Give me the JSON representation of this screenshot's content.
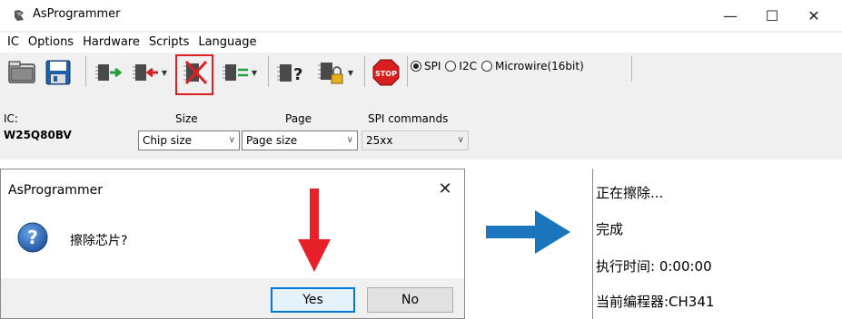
{
  "window": {
    "title": "AsProgrammer",
    "controls": {
      "minimize": "—",
      "maximize": "☐",
      "close": "✕"
    }
  },
  "menu": [
    "IC",
    "Options",
    "Hardware",
    "Scripts",
    "Language"
  ],
  "toolbar": {
    "icons": [
      "open-file-icon",
      "save-file-icon",
      "read-chip-icon",
      "write-chip-icon",
      "erase-chip-icon",
      "verify-chip-icon",
      "chip-id-icon",
      "lock-chip-icon",
      "stop-icon"
    ],
    "stop_label": "STOP",
    "highlighted_tool": "erase-chip-icon",
    "protocols": {
      "selected": "SPI",
      "spi": "SPI",
      "i2c": "I2C",
      "microwire": "Microwire(16bit)"
    }
  },
  "settings": {
    "ic_label": "IC:",
    "ic_value": "W25Q80BV",
    "size_label": "Size",
    "size_value": "Chip size",
    "page_label": "Page",
    "page_value": "Page size",
    "spi_label": "SPI commands",
    "spi_value": "25xx"
  },
  "dialog": {
    "title": "AsProgrammer",
    "close": "✕",
    "message": "擦除芯片?",
    "yes": "Yes",
    "no": "No"
  },
  "log": {
    "lines": [
      "正在擦除...",
      "完成",
      "执行时间: 0:00:00",
      "当前编程器:CH341"
    ]
  },
  "colors": {
    "highlight": "#e02020",
    "red_arrow": "#e8202a",
    "blue_arrow": "#1b75bc",
    "dialog_default_button": "#0078d7"
  }
}
